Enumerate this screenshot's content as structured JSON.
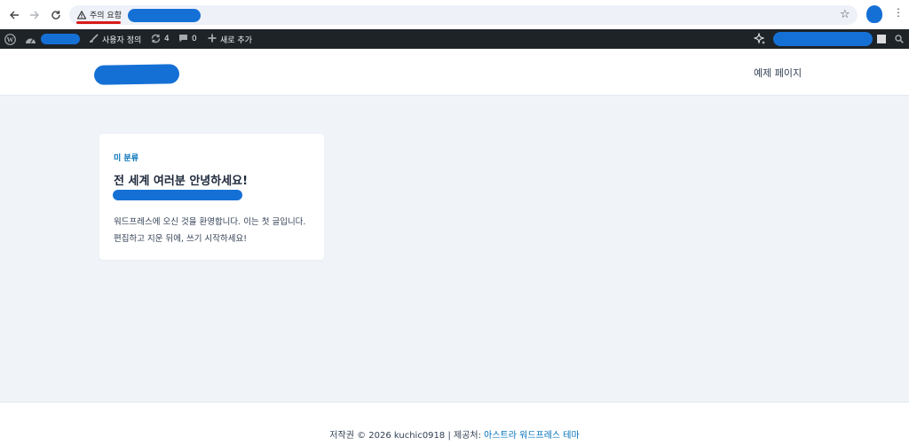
{
  "browser": {
    "security_warning": "주의 요함",
    "icons": [
      "back-arrow-icon",
      "forward-arrow-icon",
      "reload-icon",
      "warning-triangle-icon",
      "star-icon",
      "kebab-menu-icon"
    ],
    "warning_color": "#d81b1b"
  },
  "adminbar": {
    "customize_label": "사용자 정의",
    "updates_count": "4",
    "comments_count": "0",
    "new_label": "새로 추가"
  },
  "header": {
    "menu_items": [
      "예제 페이지"
    ]
  },
  "post": {
    "category": "미 분류",
    "title": "전 세계 여러분 안녕하세요!",
    "excerpt": "워드프레스에 오신 것을 환영합니다. 이는 첫 글입니다. 편집하고 지운 뒤에, 쓰기 시작하세요!"
  },
  "footer": {
    "copyright": "저작권 © 2026 kuchic0918 | 제공처: ",
    "theme_link": "아스트라 워드프레스 테마"
  },
  "colors": {
    "accent": "#0170b9",
    "adminbar_bg": "#1d2327",
    "content_bg": "#f0f4f8",
    "redaction": "#1570d6"
  }
}
